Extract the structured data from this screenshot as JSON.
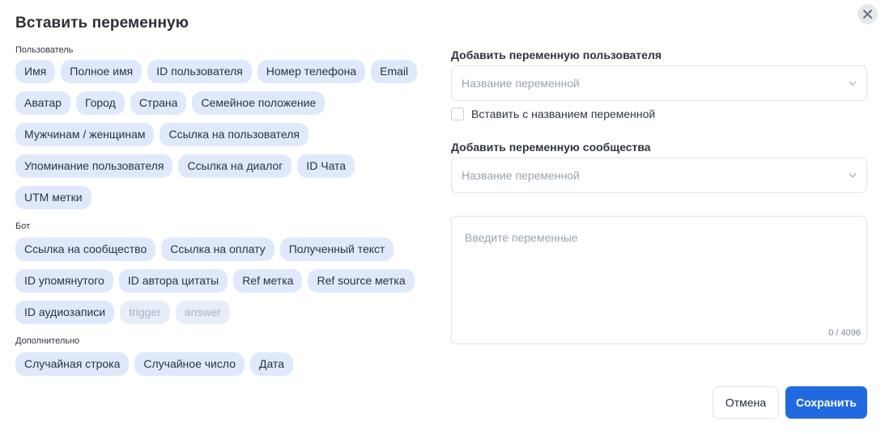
{
  "dialog": {
    "title": "Вставить переменную",
    "close_icon": "close-icon"
  },
  "sections": {
    "user": {
      "label": "Пользователь",
      "rows": [
        [
          "Имя",
          "Полное имя",
          "ID пользователя",
          "Номер телефона",
          "Email"
        ],
        [
          "Аватар",
          "Город",
          "Страна",
          "Семейное положение"
        ],
        [
          "Мужчинам / женщинам",
          "Ссылка на пользователя"
        ],
        [
          "Упоминание пользователя",
          "Ссылка на диалог",
          "ID Чата"
        ],
        [
          "UTM метки"
        ]
      ]
    },
    "bot": {
      "label": "Бот",
      "rows": [
        [
          "Ссылка на сообщество",
          "Ссылка на оплату",
          "Полученный текст"
        ],
        [
          "ID упомянутого",
          "ID автора цитаты",
          "Ref метка",
          "Ref source метка"
        ],
        [
          "ID аудиозаписи",
          "trigger",
          "answer"
        ]
      ],
      "disabled": [
        "trigger",
        "answer"
      ]
    },
    "extra": {
      "label": "Дополнительно",
      "rows": [
        [
          "Случайная строка",
          "Случайное число",
          "Дата"
        ]
      ]
    }
  },
  "form": {
    "user_var_label": "Добавить переменную пользователя",
    "user_var_placeholder": "Название переменной",
    "insert_with_name_label": "Вставить с названием переменной",
    "insert_with_name_checked": false,
    "community_var_label": "Добавить переменную сообщества",
    "community_var_placeholder": "Название переменной",
    "textarea_placeholder": "Введите переменные",
    "textarea_value": "",
    "counter": "0 / 4096",
    "chevron_icon": "chevron-down-icon"
  },
  "buttons": {
    "cancel": "Отмена",
    "save": "Сохранить"
  },
  "colors": {
    "chip_bg": "#dfe9fb",
    "primary": "#2169e0",
    "disabled_text": "#a9b3c2"
  }
}
